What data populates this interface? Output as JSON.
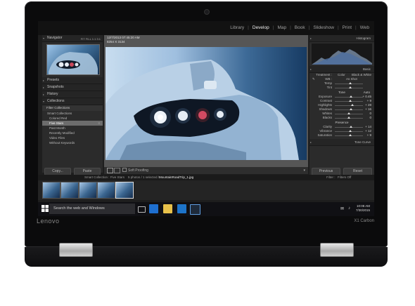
{
  "device": {
    "brand": "Lenovo",
    "model": "X1 Carbon"
  },
  "lightroom": {
    "modules": [
      "Library",
      "Develop",
      "Map",
      "Book",
      "Slideshow",
      "Print",
      "Web"
    ],
    "active_module": "Develop",
    "left_panel": {
      "navigator": "Navigator",
      "nav_zoom": "FIT FILL 1:1 3:1",
      "presets": "Presets",
      "snapshots": "Snapshots",
      "history": "History",
      "collections": "Collections",
      "filter": "Filter Collections",
      "groups": [
        "Smart Collections"
      ],
      "items": [
        {
          "label": "Colored Red",
          "count": ""
        },
        {
          "label": "Five Stars",
          "count": "8"
        },
        {
          "label": "Past Month",
          "count": ""
        },
        {
          "label": "Recently Modified",
          "count": ""
        },
        {
          "label": "Video Files",
          "count": ""
        },
        {
          "label": "Without Keywords",
          "count": ""
        }
      ],
      "copy_button": "Copy...",
      "paste_button": "Paste"
    },
    "photo_info": {
      "line1": "12/7/2013 07:45:20 AM",
      "line2": "8254 X 3134"
    },
    "toolbar": {
      "soft_proofing": "Soft Proofing"
    },
    "right_panel": {
      "histogram": "Histogram",
      "basic": "Basic",
      "treatment_label": "Treatment :",
      "treatment_color": "Color",
      "treatment_bw": "Black & White",
      "wb_label": "WB :",
      "wb_value": "As Shot",
      "temp": "Temp",
      "tint": "Tint",
      "tone": "Tone",
      "auto": "Auto",
      "sliders": [
        {
          "label": "Exposure",
          "value": "+ 0.45",
          "level": 0.58
        },
        {
          "label": "Contrast",
          "value": "+ 9",
          "level": 0.55
        },
        {
          "label": "Highlights",
          "value": "+ 28",
          "level": 0.62
        },
        {
          "label": "Shadows",
          "value": "+ 16",
          "level": 0.58
        },
        {
          "label": "Whites",
          "value": "0",
          "level": 0.5
        },
        {
          "label": "Blacks",
          "value": "0",
          "level": 0.5
        }
      ],
      "presence": "Presence",
      "presence_sliders": [
        {
          "label": "Clarity",
          "value": "+ 14",
          "level": 0.57
        },
        {
          "label": "Vibrance",
          "value": "+ 12",
          "level": 0.56
        },
        {
          "label": "Saturation",
          "value": "+ 9",
          "level": 0.55
        }
      ],
      "tone_curve": "Tone Curve",
      "previous_button": "Previous",
      "reset_button": "Reset"
    },
    "filmstrip": {
      "collection": "Smart Collection : Five Stars",
      "selection_info": "5 photos / 1 selected /",
      "filename": "MountainRoadTrip_1.jpg",
      "filter_label": "Filter :",
      "filter_value": "Filters Off"
    }
  },
  "taskbar": {
    "search_placeholder": "Search the web and Windows",
    "time": "10:08 AM",
    "date": "7/30/2015"
  }
}
